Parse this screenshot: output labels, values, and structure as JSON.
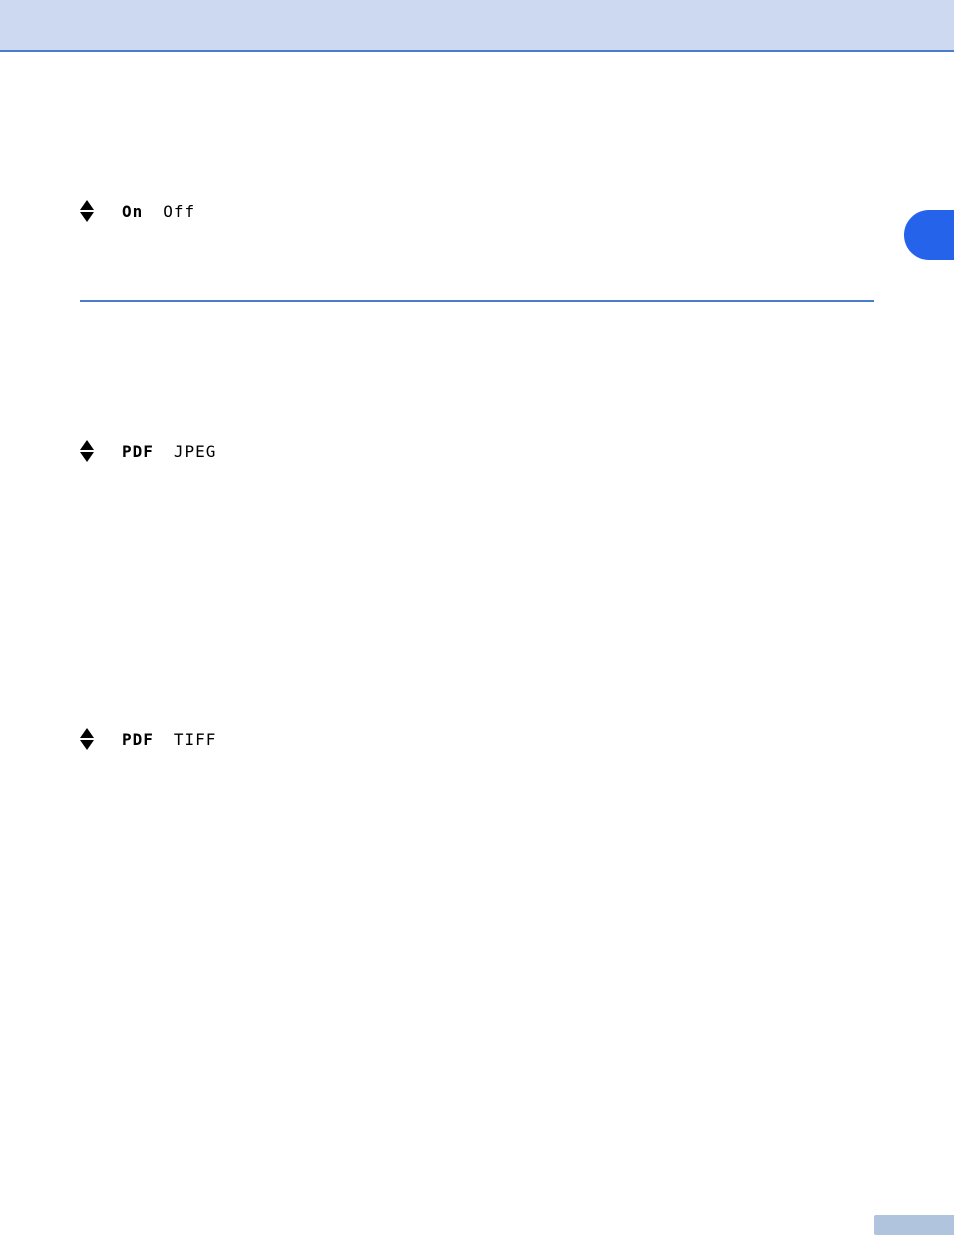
{
  "header": {
    "background": "#ccd9f0",
    "border_color": "#4a7cc7"
  },
  "sections": [
    {
      "id": "section1",
      "controls": [
        {
          "id": "ctrl1",
          "arrow_up_label": "▲",
          "arrow_down_label": "▼",
          "options": [
            "On",
            "Off"
          ],
          "selected": "On"
        }
      ]
    },
    {
      "id": "section2",
      "controls": [
        {
          "id": "ctrl2",
          "arrow_up_label": "▲",
          "arrow_down_label": "▼",
          "options": [
            "PDF",
            "JPEG"
          ],
          "selected": "PDF"
        }
      ]
    },
    {
      "id": "section3",
      "controls": [
        {
          "id": "ctrl3",
          "arrow_up_label": "▲",
          "arrow_down_label": "▼",
          "options": [
            "PDF",
            "TIFF"
          ],
          "selected": "PDF"
        }
      ]
    }
  ],
  "ui": {
    "blue_circle_color": "#2563eb",
    "divider_color": "#4a7cc7",
    "scrollbar_color": "#b0c4de"
  }
}
